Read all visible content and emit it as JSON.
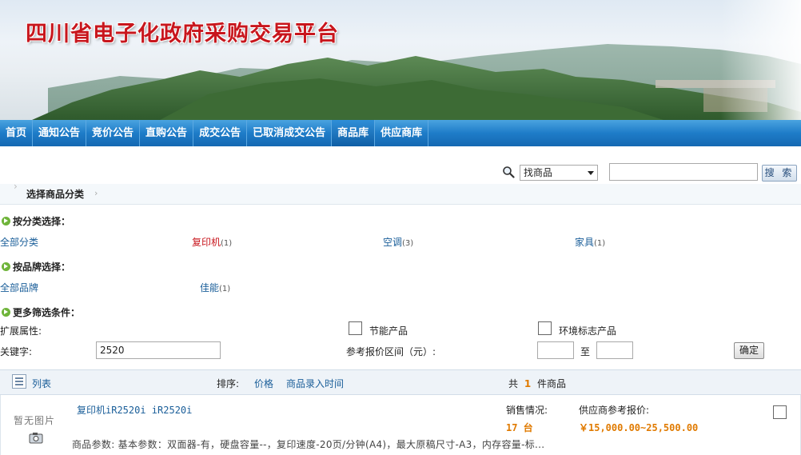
{
  "banner": {
    "title": "四川省电子化政府采购交易平台"
  },
  "nav": {
    "items": [
      {
        "label": "首页"
      },
      {
        "label": "通知公告"
      },
      {
        "label": "竞价公告"
      },
      {
        "label": "直购公告"
      },
      {
        "label": "成交公告"
      },
      {
        "label": "已取消成交公告"
      },
      {
        "label": "商品库"
      },
      {
        "label": "供应商库"
      }
    ],
    "active": "商品库"
  },
  "search": {
    "select_value": "找商品",
    "input_value": "",
    "button_label": "搜 索"
  },
  "breadcrumb": {
    "label": "选择商品分类"
  },
  "category": {
    "heading": "按分类选择：",
    "items": [
      {
        "label": "全部分类",
        "count": ""
      },
      {
        "label": "复印机",
        "count": "(1)"
      },
      {
        "label": "空调",
        "count": "(3)"
      },
      {
        "label": "家具",
        "count": "(1)"
      }
    ]
  },
  "brand": {
    "heading": "按品牌选择：",
    "items": [
      {
        "label": "全部品牌",
        "count": ""
      },
      {
        "label": "佳能",
        "count": "(1)"
      }
    ]
  },
  "filters": {
    "heading": "更多筛选条件：",
    "ext_label": "扩展属性:",
    "energy_label": "节能产品",
    "eco_label": "环境标志产品",
    "keyword_label": "关键字:",
    "keyword_value": "2520",
    "price_label": "参考报价区间（元）:",
    "price_to": "至",
    "price_min": "",
    "price_max": "",
    "confirm_label": "确定"
  },
  "list_header": {
    "view_label": "列表",
    "sort_label": "排序:",
    "sort_price": "价格",
    "sort_time": "商品录入时间",
    "total_prefix": "共",
    "total_count": "1",
    "total_suffix": "件商品"
  },
  "products": [
    {
      "thumb_text": "暂无图片",
      "name": "复印机iR2520i iR2520i",
      "sales_label": "销售情况:",
      "sales_value": "17 台",
      "price_label": "供应商参考报价:",
      "price_value": "￥15,000.00~25,500.00",
      "params": "商品参数:  基本参数：双面器-有，硬盘容量--，复印速度-20页/分钟(A4)，最大原稿尺寸-A3，内存容量-标..."
    }
  ]
}
